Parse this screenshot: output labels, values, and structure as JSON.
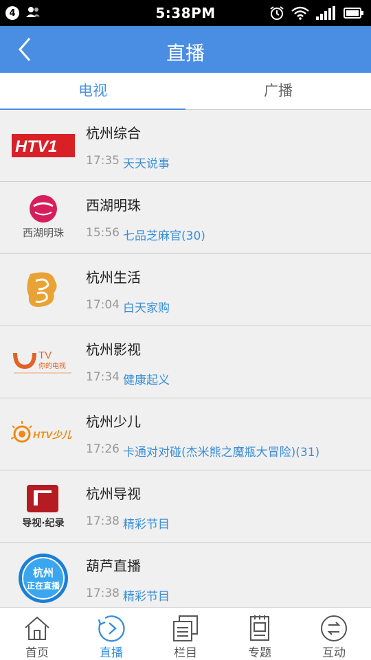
{
  "status_bar": {
    "time": "5:38PM",
    "notification_count": "4"
  },
  "header": {
    "title": "直播"
  },
  "tabs": [
    {
      "label": "电视",
      "active": true
    },
    {
      "label": "广播",
      "active": false
    }
  ],
  "channels": [
    {
      "name": "杭州综合",
      "time": "17:35",
      "program": "天天说事",
      "logo_text": "HTV1"
    },
    {
      "name": "西湖明珠",
      "time": "15:56",
      "program": "七品芝麻官(30)",
      "logo_text": "西湖明珠"
    },
    {
      "name": "杭州生活",
      "time": "17:04",
      "program": "白天家购",
      "logo_text": ""
    },
    {
      "name": "杭州影视",
      "time": "17:34",
      "program": "健康起义",
      "logo_text": "你的电视"
    },
    {
      "name": "杭州少儿",
      "time": "17:26",
      "program": "卡通对对碰(杰米熊之魔瓶大冒险)(31)",
      "logo_text": "HTV少儿"
    },
    {
      "name": "杭州导视",
      "time": "17:38",
      "program": "精彩节目",
      "logo_text": "导视·纪录"
    },
    {
      "name": "葫芦直播",
      "time": "17:38",
      "program": "精彩节目",
      "logo_text": "杭州 正在直播"
    }
  ],
  "bottom_nav": [
    {
      "label": "首页",
      "icon": "home-icon",
      "active": false
    },
    {
      "label": "直播",
      "icon": "live-play-icon",
      "active": true
    },
    {
      "label": "栏目",
      "icon": "columns-icon",
      "active": false
    },
    {
      "label": "专题",
      "icon": "topics-icon",
      "active": false
    },
    {
      "label": "互动",
      "icon": "interact-icon",
      "active": false
    }
  ],
  "colors": {
    "accent": "#4a8ee3",
    "program_text": "#3a8ed8"
  }
}
